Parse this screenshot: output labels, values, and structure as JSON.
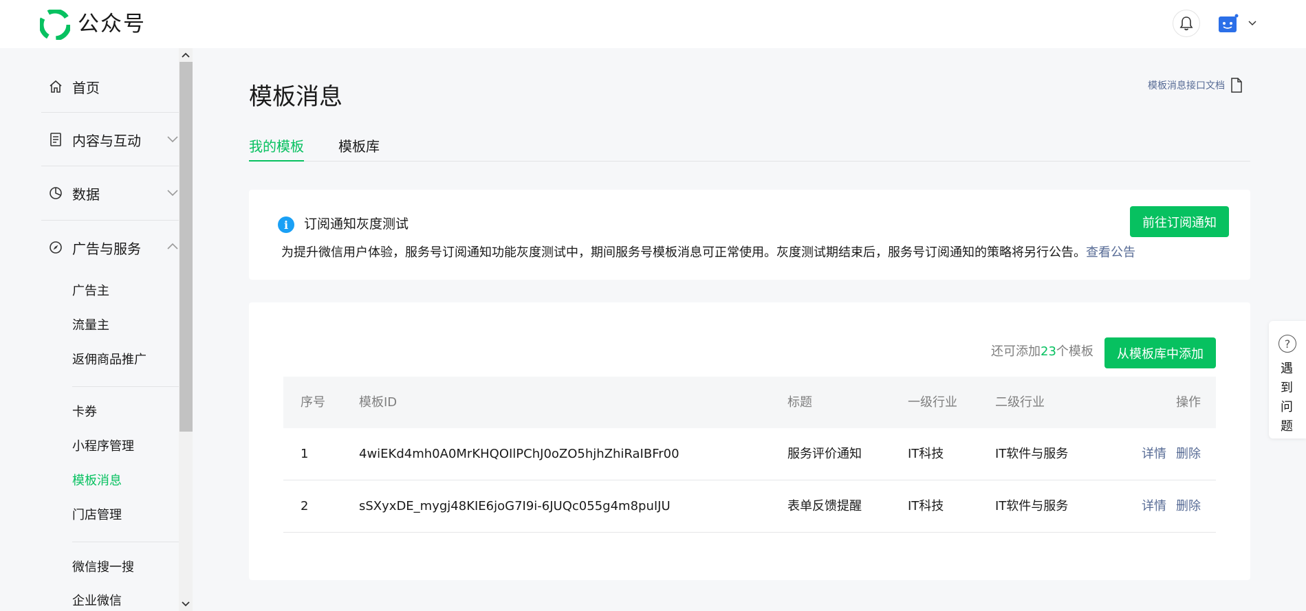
{
  "header": {
    "brand": "公众号"
  },
  "sidebar": {
    "home": "首页",
    "content": "内容与互动",
    "data": "数据",
    "ads": "广告与服务",
    "sub_items": [
      "广告主",
      "流量主",
      "返佣商品推广",
      "卡券",
      "小程序管理",
      "模板消息",
      "门店管理",
      "微信搜一搜",
      "企业微信"
    ],
    "active_item": "模板消息"
  },
  "main": {
    "title": "模板消息",
    "doc_link": "模板消息接口文档",
    "tabs": [
      {
        "label": "我的模板",
        "active": true
      },
      {
        "label": "模板库",
        "active": false
      }
    ]
  },
  "notice": {
    "title": "订阅通知灰度测试",
    "text": "为提升微信用户体验，服务号订阅通知功能灰度测试中，期间服务号模板消息可正常使用。灰度测试期结束后，服务号订阅通知的策略将另行公告。",
    "link": "查看公告",
    "button": "前往订阅通知"
  },
  "templates": {
    "quota_prefix": "还可添加",
    "quota_count": "23",
    "quota_suffix": "个模板",
    "add_button": "从模板库中添加",
    "columns": [
      "序号",
      "模板ID",
      "标题",
      "一级行业",
      "二级行业",
      "操作"
    ],
    "rows": [
      {
        "index": "1",
        "id": "4wiEKd4mh0A0MrKHQOIlPChJ0oZO5hjhZhiRaIBFr00",
        "title": "服务评价通知",
        "industry1": "IT科技",
        "industry2": "IT软件与服务",
        "detail": "详情",
        "delete": "删除"
      },
      {
        "index": "2",
        "id": "sSXyxDE_mygj48KIE6joG7I9i-6JUQc055g4m8puIJU",
        "title": "表单反馈提醒",
        "industry1": "IT科技",
        "industry2": "IT软件与服务",
        "detail": "详情",
        "delete": "删除"
      }
    ]
  },
  "help": {
    "label": "遇到问题"
  },
  "colors": {
    "accent": "#07c160",
    "link": "#576b95",
    "info": "#1aa0f5"
  }
}
